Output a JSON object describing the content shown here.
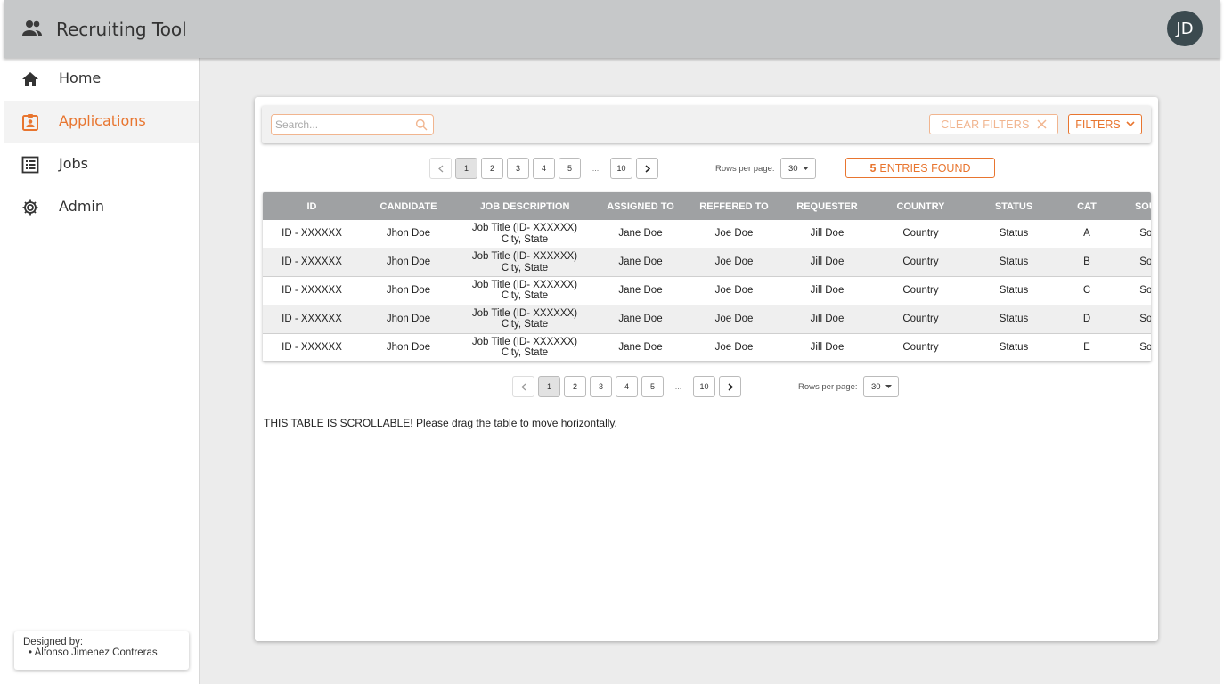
{
  "header": {
    "title": "Recruiting Tool",
    "logo_icon": "people-icon",
    "avatar_initials": "JD"
  },
  "sidebar": {
    "items": [
      {
        "label": "Home",
        "icon": "home-icon",
        "active": false
      },
      {
        "label": "Applications",
        "icon": "clipboard-user-icon",
        "active": true
      },
      {
        "label": "Jobs",
        "icon": "list-icon",
        "active": false
      },
      {
        "label": "Admin",
        "icon": "gear-icon",
        "active": false
      }
    ],
    "credits": {
      "title": "Designed by:",
      "name": "Alfonso Jimenez Contreras"
    }
  },
  "toolbar": {
    "search_placeholder": "Search...",
    "clear_filters_label": "CLEAR FILTERS",
    "filters_label": "FILTERS"
  },
  "pagination": {
    "pages": [
      "1",
      "2",
      "3",
      "4",
      "5"
    ],
    "ellipsis": "...",
    "last_page": "10",
    "current_page": "1",
    "rows_per_page_label": "Rows per page:",
    "rows_per_page_value": "30"
  },
  "entries": {
    "count": "5",
    "label": "ENTRIES FOUND"
  },
  "table": {
    "columns": [
      "ID",
      "CANDIDATE",
      "JOB DESCRIPTION",
      "ASSIGNED TO",
      "REFFERED TO",
      "REQUESTER",
      "COUNTRY",
      "STATUS",
      "CAT",
      "SOURCE"
    ],
    "rows": [
      {
        "id": "ID - XXXXXX",
        "candidate": "Jhon Doe",
        "job_title": "Job Title (ID- XXXXXX)",
        "job_location": "City, State",
        "assigned": "Jane Doe",
        "referred": "Joe Doe",
        "requester": "Jill Doe",
        "country": "Country",
        "status": "Status",
        "cat": "A",
        "source": "Source"
      },
      {
        "id": "ID - XXXXXX",
        "candidate": "Jhon Doe",
        "job_title": "Job Title (ID- XXXXXX)",
        "job_location": "City, State",
        "assigned": "Jane Doe",
        "referred": "Joe Doe",
        "requester": "Jill Doe",
        "country": "Country",
        "status": "Status",
        "cat": "B",
        "source": "Source"
      },
      {
        "id": "ID - XXXXXX",
        "candidate": "Jhon Doe",
        "job_title": "Job Title (ID- XXXXXX)",
        "job_location": "City, State",
        "assigned": "Jane Doe",
        "referred": "Joe Doe",
        "requester": "Jill Doe",
        "country": "Country",
        "status": "Status",
        "cat": "C",
        "source": "Source"
      },
      {
        "id": "ID - XXXXXX",
        "candidate": "Jhon Doe",
        "job_title": "Job Title (ID- XXXXXX)",
        "job_location": "City, State",
        "assigned": "Jane Doe",
        "referred": "Joe Doe",
        "requester": "Jill Doe",
        "country": "Country",
        "status": "Status",
        "cat": "D",
        "source": "Source"
      },
      {
        "id": "ID - XXXXXX",
        "candidate": "Jhon Doe",
        "job_title": "Job Title (ID- XXXXXX)",
        "job_location": "City, State",
        "assigned": "Jane Doe",
        "referred": "Joe Doe",
        "requester": "Jill Doe",
        "country": "Country",
        "status": "Status",
        "cat": "E",
        "source": "Source"
      }
    ]
  },
  "scroll_note": "THIS TABLE IS SCROLLABLE! Please drag the table to move horizontally.",
  "colors": {
    "accent": "#e8752f",
    "accent_light": "#f1b58f",
    "header_bg": "#c6c8c9",
    "table_header_bg": "#9fa1a3",
    "avatar_bg": "#3b4a4f"
  }
}
